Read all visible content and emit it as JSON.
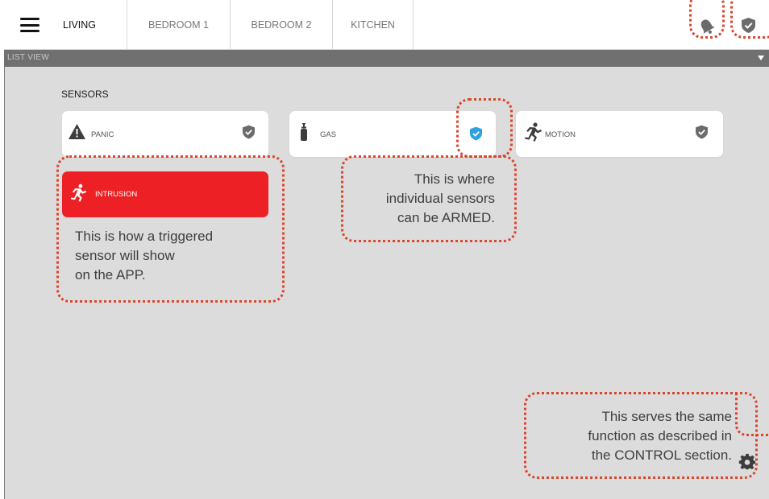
{
  "tabs": {
    "living": "LIVING",
    "bedroom1": "BEDROOM 1",
    "bedroom2": "BEDROOM 2",
    "kitchen": "KITCHEN"
  },
  "view_bar": {
    "label": "LIST VIEW"
  },
  "sensors": {
    "title": "SENSORS",
    "panic": "PANIC",
    "gas": "GAS",
    "motion": "MOTION",
    "intrusion": "INTRUSION"
  },
  "annotations": {
    "triggered": [
      "This is how a triggered",
      "sensor will show",
      "on the APP."
    ],
    "armed": [
      "This is where",
      "individual sensors",
      "can be ARMED."
    ],
    "control": [
      "This serves the same",
      "function as described in",
      "the CONTROL section."
    ]
  },
  "colors": {
    "alarm": "#ed2125",
    "armed": "#2fa0e0",
    "callout": "#d9452c",
    "view_bar": "#707070",
    "background": "#dcdcdc"
  },
  "icons": [
    "menu-icon",
    "bell-icon",
    "shield-icon",
    "warning-icon",
    "gas-cylinder-icon",
    "running-person-icon",
    "gear-icon",
    "chevron-down-icon"
  ]
}
